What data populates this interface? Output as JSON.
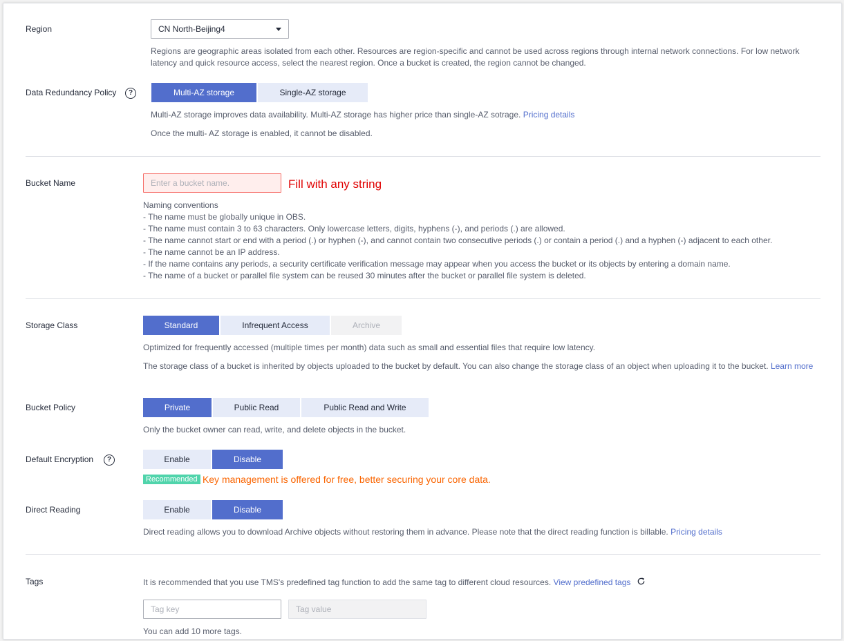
{
  "region": {
    "label": "Region",
    "selected": "CN North-Beijing4",
    "description": "Regions are geographic areas isolated from each other. Resources are region-specific and cannot be used across regions through internal network connections. For low network latency and quick resource access, select the nearest region. Once a bucket is created, the region cannot be changed."
  },
  "redundancy": {
    "label": "Data Redundancy Policy",
    "help_icon": "question-circle-icon",
    "options": [
      "Multi-AZ storage",
      "Single-AZ storage"
    ],
    "selected": "Multi-AZ storage",
    "description": "Multi-AZ storage improves data availability. Multi-AZ storage has higher price than single-AZ sotrage.",
    "pricing_link": "Pricing details",
    "note": "Once the multi- AZ storage is enabled, it cannot be disabled."
  },
  "bucket_name": {
    "label": "Bucket Name",
    "placeholder": "Enter a bucket name.",
    "value": "",
    "annotation": "Fill with any string",
    "conventions_title": "Naming conventions",
    "conventions": [
      "- The name must be globally unique in OBS.",
      "- The name must contain 3 to 63 characters. Only lowercase letters, digits, hyphens (-), and periods (.) are allowed.",
      "- The name cannot start or end with a period (.) or hyphen (-), and cannot contain two consecutive periods (.) or contain a period (.) and a hyphen (-) adjacent to each other.",
      "- The name cannot be an IP address.",
      "- If the name contains any periods, a security certificate verification message may appear when you access the bucket or its objects by entering a domain name.",
      "- The name of a bucket or parallel file system can be reused 30 minutes after the bucket or parallel file system is deleted."
    ]
  },
  "storage_class": {
    "label": "Storage Class",
    "options": [
      "Standard",
      "Infrequent Access",
      "Archive"
    ],
    "selected": "Standard",
    "disabled": "Archive",
    "description": "Optimized for frequently accessed (multiple times per month) data such as small and essential files that require low latency.",
    "note": "The storage class of a bucket is inherited by objects uploaded to the bucket by default. You can also change the storage class of an object when uploading it to the bucket.",
    "learn_more_link": "Learn more"
  },
  "bucket_policy": {
    "label": "Bucket Policy",
    "options": [
      "Private",
      "Public Read",
      "Public Read and Write"
    ],
    "selected": "Private",
    "description": "Only the bucket owner can read, write, and delete objects in the bucket."
  },
  "encryption": {
    "label": "Default Encryption",
    "help_icon": "question-circle-icon",
    "options": [
      "Enable",
      "Disable"
    ],
    "selected": "Disable",
    "badge": "Recommended",
    "recommendation": "Key management is offered for free, better securing your core data."
  },
  "direct_reading": {
    "label": "Direct Reading",
    "options": [
      "Enable",
      "Disable"
    ],
    "selected": "Disable",
    "description": "Direct reading allows you to download Archive objects without restoring them in advance. Please note that the direct reading function is billable.",
    "pricing_link": "Pricing details"
  },
  "tags": {
    "label": "Tags",
    "description": "It is recommended that you use TMS's predefined tag function to add the same tag to different cloud resources.",
    "view_link": "View predefined tags",
    "refresh_icon": "refresh-icon",
    "key_placeholder": "Tag key",
    "value_placeholder": "Tag value",
    "remaining": "You can add 10 more tags."
  },
  "colors": {
    "primary": "#526ecc",
    "segment_bg": "#e6ebf8",
    "annotation_red": "#e00000",
    "badge_green": "#50d4ab",
    "warning_orange": "#fa6400",
    "error_bg": "#ffeeed"
  }
}
